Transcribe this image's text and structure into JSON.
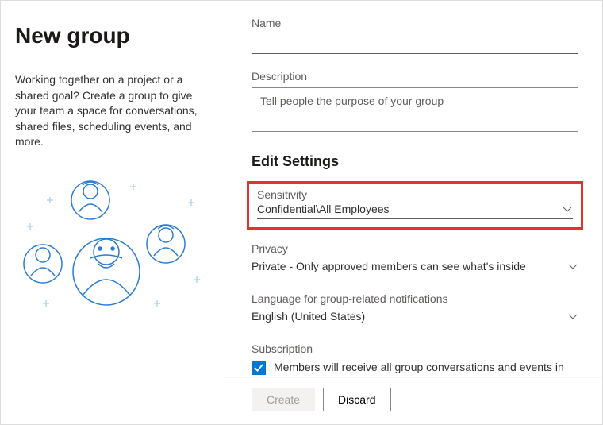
{
  "header": {
    "title": "New group",
    "subtitle": "Working together on a project or a shared goal? Create a group to give your team a space for conversations, shared files, scheduling events, and more."
  },
  "form": {
    "name": {
      "label": "Name",
      "value": ""
    },
    "description": {
      "label": "Description",
      "placeholder": "Tell people the purpose of your group",
      "value": ""
    },
    "section_heading": "Edit Settings",
    "sensitivity": {
      "label": "Sensitivity",
      "value": "Confidential\\All Employees"
    },
    "privacy": {
      "label": "Privacy",
      "value": "Private - Only approved members can see what's inside"
    },
    "language": {
      "label": "Language for group-related notifications",
      "value": "English (United States)"
    },
    "subscription": {
      "label": "Subscription",
      "checked": true,
      "text": "Members will receive all group conversations and events in their inboxes. They can stop following this group later if they"
    }
  },
  "footer": {
    "create_label": "Create",
    "discard_label": "Discard"
  }
}
